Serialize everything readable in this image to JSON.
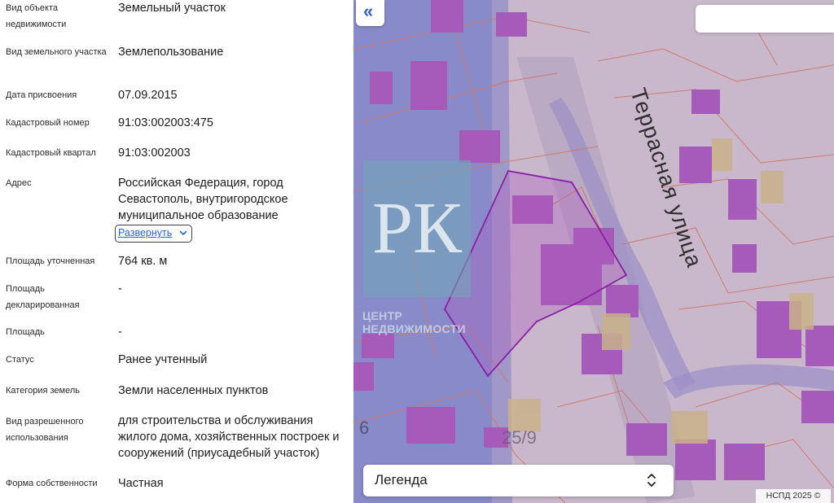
{
  "details": [
    {
      "label": "Вид объекта недвижимости",
      "value": "Земельный участок"
    },
    {
      "label": "Вид земельного участка",
      "value": "Землепользование"
    },
    {
      "label": "Дата присвоения",
      "value": "07.09.2015"
    },
    {
      "label": "Кадастровый номер",
      "value": "91:03:002003:475"
    },
    {
      "label": "Кадастровый квартал",
      "value": "91:03:002003"
    },
    {
      "label": "Адрес",
      "value": "Российская Федерация, город Севастополь, внутригородское муниципальное образование"
    },
    {
      "label": "Площадь уточненная",
      "value": "764 кв. м"
    },
    {
      "label": "Площадь декларированная",
      "value": "-"
    },
    {
      "label": "Площадь",
      "value": "-"
    },
    {
      "label": "Статус",
      "value": "Ранее учтенный"
    },
    {
      "label": "Категория земель",
      "value": "Земли населенных пунктов"
    },
    {
      "label": "Вид разрешенного использования",
      "value": "для строительства и обслуживания жилого дома, хозяйственных построек и сооружений (приусадебный участок)"
    },
    {
      "label": "Форма собственности",
      "value": "Частная"
    }
  ],
  "expand_label": "Развернуть",
  "map": {
    "street_label": "Террасная улица",
    "parcel_labels": [
      "6",
      "25/9"
    ],
    "watermark": {
      "logo_letters": "РК",
      "text_line1": "ЦЕНТР",
      "text_line2": "НЕДВИЖИМОСТИ"
    },
    "legend_label": "Легенда",
    "copyright": "НСПД 2025 ©",
    "search_placeholder": ""
  },
  "colors": {
    "link": "#2a66d9",
    "parcel_fill": "#c9b8cb",
    "building": "#a65ab9",
    "zone_overlay": "#6f78c8",
    "selected_outline": "#8a1fa5",
    "cadastral_line": "#d07a6a"
  },
  "icons": [
    "double-chevron-left-icon",
    "chevron-down-icon",
    "up-down-chevron-icon"
  ]
}
